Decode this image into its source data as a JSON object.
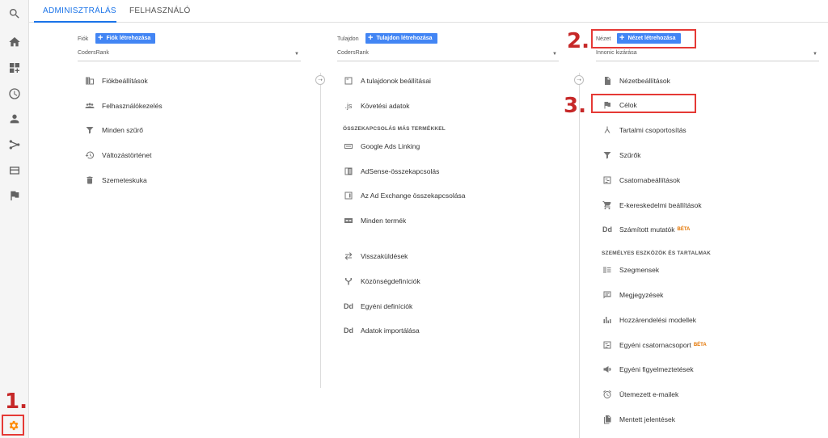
{
  "tabs": [
    {
      "label": "ADMINISZTRÁLÁS",
      "active": true
    },
    {
      "label": "FELHASZNÁLÓ",
      "active": false
    }
  ],
  "rail": {
    "icons": [
      "search-icon",
      "home-icon",
      "dashboards-icon",
      "clock-icon",
      "person-icon",
      "acquisition-icon",
      "behavior-icon",
      "flag-icon",
      "admin-gear-icon"
    ]
  },
  "callouts": {
    "one": "1.",
    "two": "2.",
    "three": "3."
  },
  "account": {
    "label": "Fiók",
    "create": "Fiók létrehozása",
    "selected": "CodersRank",
    "items": [
      {
        "label": "Fiókbeállítások",
        "icon": "building-icon"
      },
      {
        "label": "Felhasználókezelés",
        "icon": "users-icon"
      },
      {
        "label": "Minden szűrő",
        "icon": "filter-icon"
      },
      {
        "label": "Változástörténet",
        "icon": "history-icon"
      },
      {
        "label": "Szemeteskuka",
        "icon": "trash-icon"
      }
    ]
  },
  "property": {
    "label": "Tulajdon",
    "create": "Tulajdon létrehozása",
    "selected": "CodersRank",
    "items_top": [
      {
        "label": "A tulajdonok beállításai",
        "icon": "property-settings-icon"
      },
      {
        "label": "Követési adatok",
        "icon": "js-icon",
        "glyph": ".js"
      }
    ],
    "section": "ÖSSZEKAPCSOLÁS MÁS TERMÉKKEL",
    "items_linking": [
      {
        "label": "Google Ads Linking",
        "icon": "ads-icon"
      },
      {
        "label": "AdSense-összekapcsolás",
        "icon": "adsense-icon"
      },
      {
        "label": "Az Ad Exchange összekapcsolása",
        "icon": "adexchange-icon"
      },
      {
        "label": "Minden termék",
        "icon": "link-icon"
      }
    ],
    "items_bottom": [
      {
        "label": "Visszaküldések",
        "icon": "postbacks-icon"
      },
      {
        "label": "Közönségdefiníciók",
        "icon": "audience-icon"
      },
      {
        "label": "Egyéni definíciók",
        "icon": "dd-icon",
        "glyph": "Dd"
      },
      {
        "label": "Adatok importálása",
        "icon": "dd-icon",
        "glyph": "Dd"
      }
    ]
  },
  "view": {
    "label": "Nézet",
    "create": "Nézet létrehozása",
    "selected": "Innonic kizárása",
    "items_top": [
      {
        "label": "Nézetbeállítások",
        "icon": "document-icon"
      },
      {
        "label": "Célok",
        "icon": "goal-flag-icon"
      },
      {
        "label": "Tartalmi csoportosítás",
        "icon": "content-grouping-icon"
      },
      {
        "label": "Szűrők",
        "icon": "filter-icon"
      },
      {
        "label": "Csatornabeállítások",
        "icon": "channel-settings-icon"
      },
      {
        "label": "E-kereskedelmi beállítások",
        "icon": "cart-icon"
      },
      {
        "label": "Számított mutatók",
        "icon": "dd-icon",
        "glyph": "Dd",
        "badge": "BÉTA"
      }
    ],
    "section": "SZEMÉLYES ESZKÖZÖK ÉS TARTALMAK",
    "items_bottom": [
      {
        "label": "Szegmensek",
        "icon": "segments-icon"
      },
      {
        "label": "Megjegyzések",
        "icon": "annotations-icon"
      },
      {
        "label": "Hozzárendelési modellek",
        "icon": "attribution-icon"
      },
      {
        "label": "Egyéni csatornacsoport",
        "icon": "channel-group-icon",
        "badge": "BÉTA"
      },
      {
        "label": "Egyéni figyelmeztetések",
        "icon": "megaphone-icon"
      },
      {
        "label": "Ütemezett e-mailek",
        "icon": "alarm-icon"
      },
      {
        "label": "Mentett jelentések",
        "icon": "saved-reports-icon"
      }
    ]
  }
}
